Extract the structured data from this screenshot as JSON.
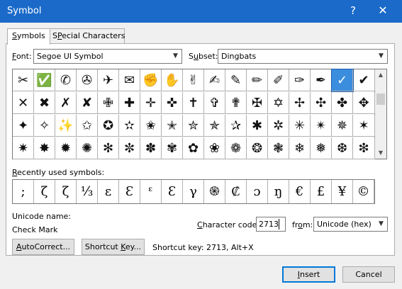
{
  "window": {
    "title": "Symbol",
    "help": "?",
    "close": "✕"
  },
  "tabs": [
    {
      "label": "Symbols",
      "accel": "S",
      "rest": "ymbols"
    },
    {
      "label": "Special Characters",
      "pre": "",
      "accel": "P",
      "rest": "ecial Characters",
      "lead": "S"
    }
  ],
  "font": {
    "label_accel": "F",
    "label_rest": "ont:",
    "value": "Segoe UI Symbol"
  },
  "subset": {
    "label_accel": "u",
    "label_pre": "S",
    "label_rest": "bset:",
    "value": "Dingbats"
  },
  "symbols": [
    "✂",
    "✅",
    "✆",
    "✇",
    "✈",
    "✉",
    "✊",
    "✋",
    "✌",
    "✍",
    "✎",
    "✏",
    "✐",
    "✑",
    "✒",
    "✓",
    "✔",
    "✕",
    "✖",
    "✗",
    "✘",
    "✙",
    "✚",
    "✛",
    "✜",
    "✝",
    "✞",
    "✟",
    "✠",
    "✡",
    "✢",
    "✣",
    "✤",
    "✥",
    "✦",
    "✧",
    "✨",
    "✩",
    "✪",
    "✫",
    "✬",
    "✭",
    "✮",
    "✯",
    "✰",
    "✱",
    "✲",
    "✳",
    "✴",
    "✵",
    "✶",
    "✷",
    "✸",
    "✹",
    "✺",
    "✻",
    "✼",
    "✽",
    "✾",
    "✿",
    "❀",
    "❁",
    "❂",
    "❃",
    "❄",
    "❅",
    "❆",
    "❇"
  ],
  "selected_symbol_index": 15,
  "recent": {
    "label": "Recently used symbols:",
    "label_accel": "R",
    "label_rest": "ecently used symbols:",
    "items": [
      ";",
      "ζ",
      "ζ",
      "⅓",
      "ε",
      "Ɛ",
      "ᵋ",
      "Ɛ",
      "γ",
      "֍",
      "₡",
      "ɔ",
      "ŋ",
      "€",
      "£",
      "¥",
      "©"
    ]
  },
  "unicode_name": {
    "label": "Unicode name:",
    "value": "Check Mark"
  },
  "character_code": {
    "label_accel": "C",
    "label_rest": "haracter code:",
    "value": "2713"
  },
  "from": {
    "label_pre": "fr",
    "label_accel": "o",
    "label_rest": "m:",
    "value": "Unicode (hex)"
  },
  "buttons": {
    "autocorrect": {
      "accel": "A",
      "rest": "utoCorrect..."
    },
    "shortcut_key": {
      "pre": "Shortcut ",
      "accel": "K",
      "rest": "ey..."
    },
    "insert": {
      "pre": "",
      "accel": "I",
      "rest": "nsert"
    },
    "cancel": "Cancel"
  },
  "shortcut_text": "Shortcut key: 2713, Alt+X",
  "colors": {
    "titlebar": "#1b6ac9",
    "selection": "#3b8ede",
    "default_button": "#0078d7"
  }
}
